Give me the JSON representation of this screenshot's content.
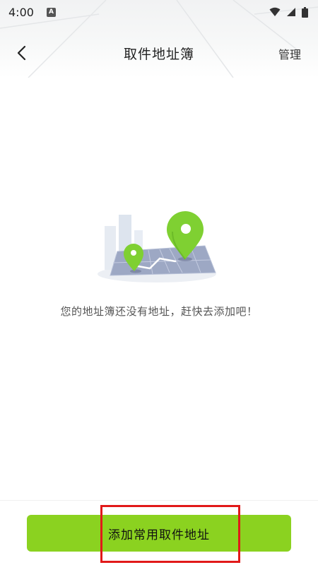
{
  "status_bar": {
    "time": "4:00",
    "notification_icon": "a-letter-icon",
    "icons": [
      "wifi-icon",
      "cellular-signal-icon",
      "battery-icon"
    ]
  },
  "header": {
    "back_icon": "chevron-left-icon",
    "title": "取件地址簿",
    "manage_label": "管理"
  },
  "empty_state": {
    "illustration": "map-pins-illustration",
    "message": "您的地址簿还没有地址，赶快去添加吧！"
  },
  "footer": {
    "add_button_label": "添加常用取件地址"
  },
  "colors": {
    "accent_green": "#8bd220",
    "pin_green": "#7fd032",
    "highlight_red": "#e11919"
  }
}
